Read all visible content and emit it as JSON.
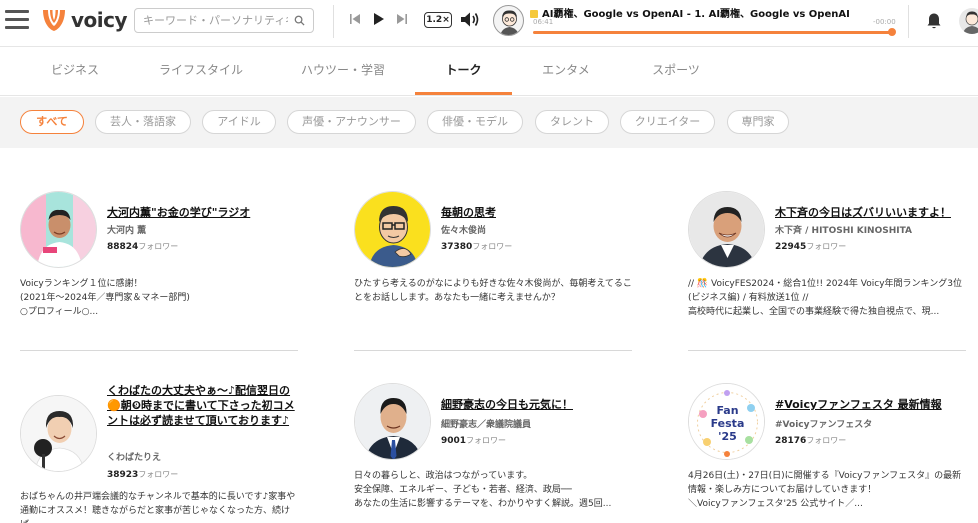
{
  "header": {
    "logo_text": "voicy",
    "search_placeholder": "キーワード・パーソナリティ名",
    "speed_label": "1.2×",
    "track_title": "AI覇権、Google vs OpenAI - 1. AI覇権、Google vs OpenAI",
    "time_current": "06:41",
    "time_remaining": "-00:00",
    "progress_fraction": 0.99
  },
  "categories": [
    {
      "label": "ビジネス",
      "active": false
    },
    {
      "label": "ライフスタイル",
      "active": false
    },
    {
      "label": "ハウツー・学習",
      "active": false
    },
    {
      "label": "トーク",
      "active": true
    },
    {
      "label": "エンタメ",
      "active": false
    },
    {
      "label": "スポーツ",
      "active": false
    }
  ],
  "filters": [
    {
      "label": "すべて",
      "active": true
    },
    {
      "label": "芸人・落語家",
      "active": false
    },
    {
      "label": "アイドル",
      "active": false
    },
    {
      "label": "声優・アナウンサー",
      "active": false
    },
    {
      "label": "俳優・モデル",
      "active": false
    },
    {
      "label": "タレント",
      "active": false
    },
    {
      "label": "クリエイター",
      "active": false
    },
    {
      "label": "専門家",
      "active": false
    }
  ],
  "followers_suffix": "フォロワー",
  "cards": [
    {
      "name": "大河内薫\"お金の学び\"ラジオ",
      "host": "大河内 薫",
      "followers": "88824",
      "desc": "Voicyランキング１位に感謝！\n(2021年〜2024年／専門家＆マネー部門)\n○プロフィール○..."
    },
    {
      "name": "毎朝の思考",
      "host": "佐々木俊尚",
      "followers": "37380",
      "desc": "ひたすら考えるのがなによりも好きな佐々木俊尚が、毎朝考えてることをお話しします。あなたも一緒に考えませんか？"
    },
    {
      "name": "木下斉の今日はズバリいいますよ！",
      "host": "木下斉 / HITOSHI KINOSHITA",
      "followers": "22945",
      "desc": "// 🎊 VoicyFES2024・総合1位!! 2024年 Voicy年間ランキング3位(ビジネス編) / 有料放送1位 //\n高校時代に起業し、全国での事業経験で得た独自視点で、現..."
    },
    {
      "name": "くわばたの大丈夫やぁ〜♪配信翌日の🟠朝❾時までに書いて下さった初コメントは必ず読ませて頂いております♪",
      "host": "くわばたりえ",
      "followers": "38923",
      "desc": "おばちゃんの井戸端会議的なチャンネルで基本的に長いです♪家事や通勤にオススメ！聴きながらだと家事が苦じゃなくなった方、続けば..."
    },
    {
      "name": "細野豪志の今日も元気に！",
      "host": "細野豪志／衆議院議員",
      "followers": "9001",
      "desc": "日々の暮らしと、政治はつながっています。\n安全保障、エネルギー、子ども・若者、経済、政局──\nあなたの生活に影響するテーマを、わかりやすく解説。週5回..."
    },
    {
      "name": "#Voicyファンフェスタ 最新情報",
      "host": "#Voicyファンフェスタ",
      "followers": "28176",
      "desc": "4月26日(土)・27日(日)に開催する『Voicyファンフェスタ』の最新情報・楽しみ方についてお届けしていきます！\n＼Voicyファンフェスタ'25 公式サイト／..."
    }
  ],
  "fan_festa_badge": "Fan Festa '25",
  "colors": {
    "accent": "#f5823c",
    "chip_border": "#d6d6d6",
    "filter_bg": "#f3f3f3"
  }
}
